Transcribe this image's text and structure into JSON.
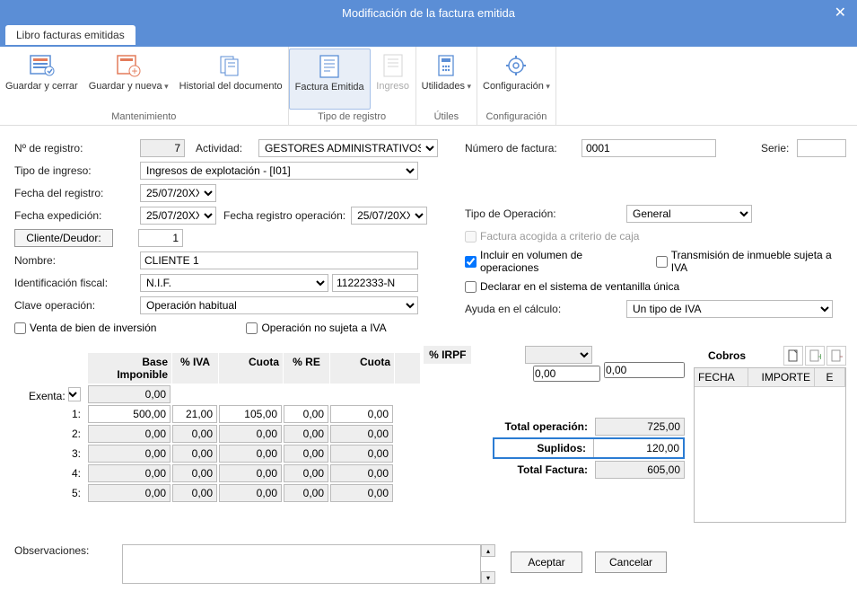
{
  "window": {
    "title": "Modificación de la factura emitida"
  },
  "tabs": {
    "main": "Libro facturas emitidas"
  },
  "ribbon": {
    "guardar_cerrar": "Guardar y cerrar",
    "guardar_nueva": "Guardar y nueva",
    "historial": "Historial del documento",
    "mantenimiento": "Mantenimiento",
    "factura_emitida": "Factura Emitida",
    "ingreso": "Ingreso",
    "tipo_registro": "Tipo de registro",
    "utilidades": "Utilidades",
    "utiles": "Útiles",
    "config": "Configuración",
    "config_grp": "Configuración"
  },
  "form": {
    "num_registro_lbl": "Nº de registro:",
    "num_registro_val": "7",
    "actividad_lbl": "Actividad:",
    "actividad_val": "GESTORES ADMINISTRATIVOS",
    "num_factura_lbl": "Número de factura:",
    "num_factura_val": "0001",
    "serie_lbl": "Serie:",
    "serie_val": "",
    "tipo_ingreso_lbl": "Tipo de ingreso:",
    "tipo_ingreso_val": "Ingresos de explotación - [I01]",
    "fecha_registro_lbl": "Fecha del registro:",
    "fecha_registro_val": "25/07/20XX",
    "fecha_expedicion_lbl": "Fecha expedición:",
    "fecha_expedicion_val": "25/07/20XX",
    "fecha_reg_op_lbl": "Fecha registro operación:",
    "fecha_reg_op_val": "25/07/20XX",
    "cliente_btn": "Cliente/Deudor:",
    "cliente_val": "1",
    "nombre_lbl": "Nombre:",
    "nombre_val": "CLIENTE 1",
    "id_fiscal_lbl": "Identificación fiscal:",
    "id_fiscal_tipo": "N.I.F.",
    "id_fiscal_num": "11222333-N",
    "clave_op_lbl": "Clave operación:",
    "clave_op_val": "Operación habitual",
    "venta_bien_lbl": "Venta de bien de inversión",
    "op_no_iva_lbl": "Operación no sujeta a IVA",
    "tipo_operacion_lbl": "Tipo de Operación:",
    "tipo_operacion_val": "General",
    "criterio_caja_lbl": "Factura acogida a criterio de caja",
    "incluir_vol_lbl": "Incluir en  volumen de operaciones",
    "transmision_lbl": "Transmisión de inmueble sujeta a IVA",
    "declarar_lbl": "Declarar en el sistema de ventanilla única",
    "ayuda_calc_lbl": "Ayuda en el cálculo:",
    "ayuda_calc_val": "Un tipo de IVA"
  },
  "grid": {
    "headers": {
      "base": "Base Imponible",
      "iva": "% IVA",
      "cuota": "Cuota",
      "re": "% RE",
      "cuota2": "Cuota",
      "irpf": "% IRPF"
    },
    "exenta_lbl": "Exenta:",
    "rows_labels": [
      "1:",
      "2:",
      "3:",
      "4:",
      "5:"
    ],
    "exenta": {
      "base": "0,00",
      "irpf_total1": "0,00",
      "irpf_total2": "0,00"
    },
    "rows": [
      {
        "base": "500,00",
        "iva": "21,00",
        "cuota": "105,00",
        "re": "0,00",
        "cuota2": "0,00"
      },
      {
        "base": "0,00",
        "iva": "0,00",
        "cuota": "0,00",
        "re": "0,00",
        "cuota2": "0,00"
      },
      {
        "base": "0,00",
        "iva": "0,00",
        "cuota": "0,00",
        "re": "0,00",
        "cuota2": "0,00"
      },
      {
        "base": "0,00",
        "iva": "0,00",
        "cuota": "0,00",
        "re": "0,00",
        "cuota2": "0,00"
      },
      {
        "base": "0,00",
        "iva": "0,00",
        "cuota": "0,00",
        "re": "0,00",
        "cuota2": "0,00"
      }
    ]
  },
  "totals": {
    "total_op_lbl": "Total operación:",
    "total_op_val": "725,00",
    "suplidos_lbl": "Suplidos:",
    "suplidos_val": "120,00",
    "total_fac_lbl": "Total Factura:",
    "total_fac_val": "605,00"
  },
  "cobros": {
    "title": "Cobros",
    "col_fecha": "FECHA",
    "col_importe": "IMPORTE",
    "col_e": "E"
  },
  "obs": {
    "lbl": "Observaciones:",
    "val": ""
  },
  "footer": {
    "aceptar": "Aceptar",
    "cancelar": "Cancelar"
  }
}
